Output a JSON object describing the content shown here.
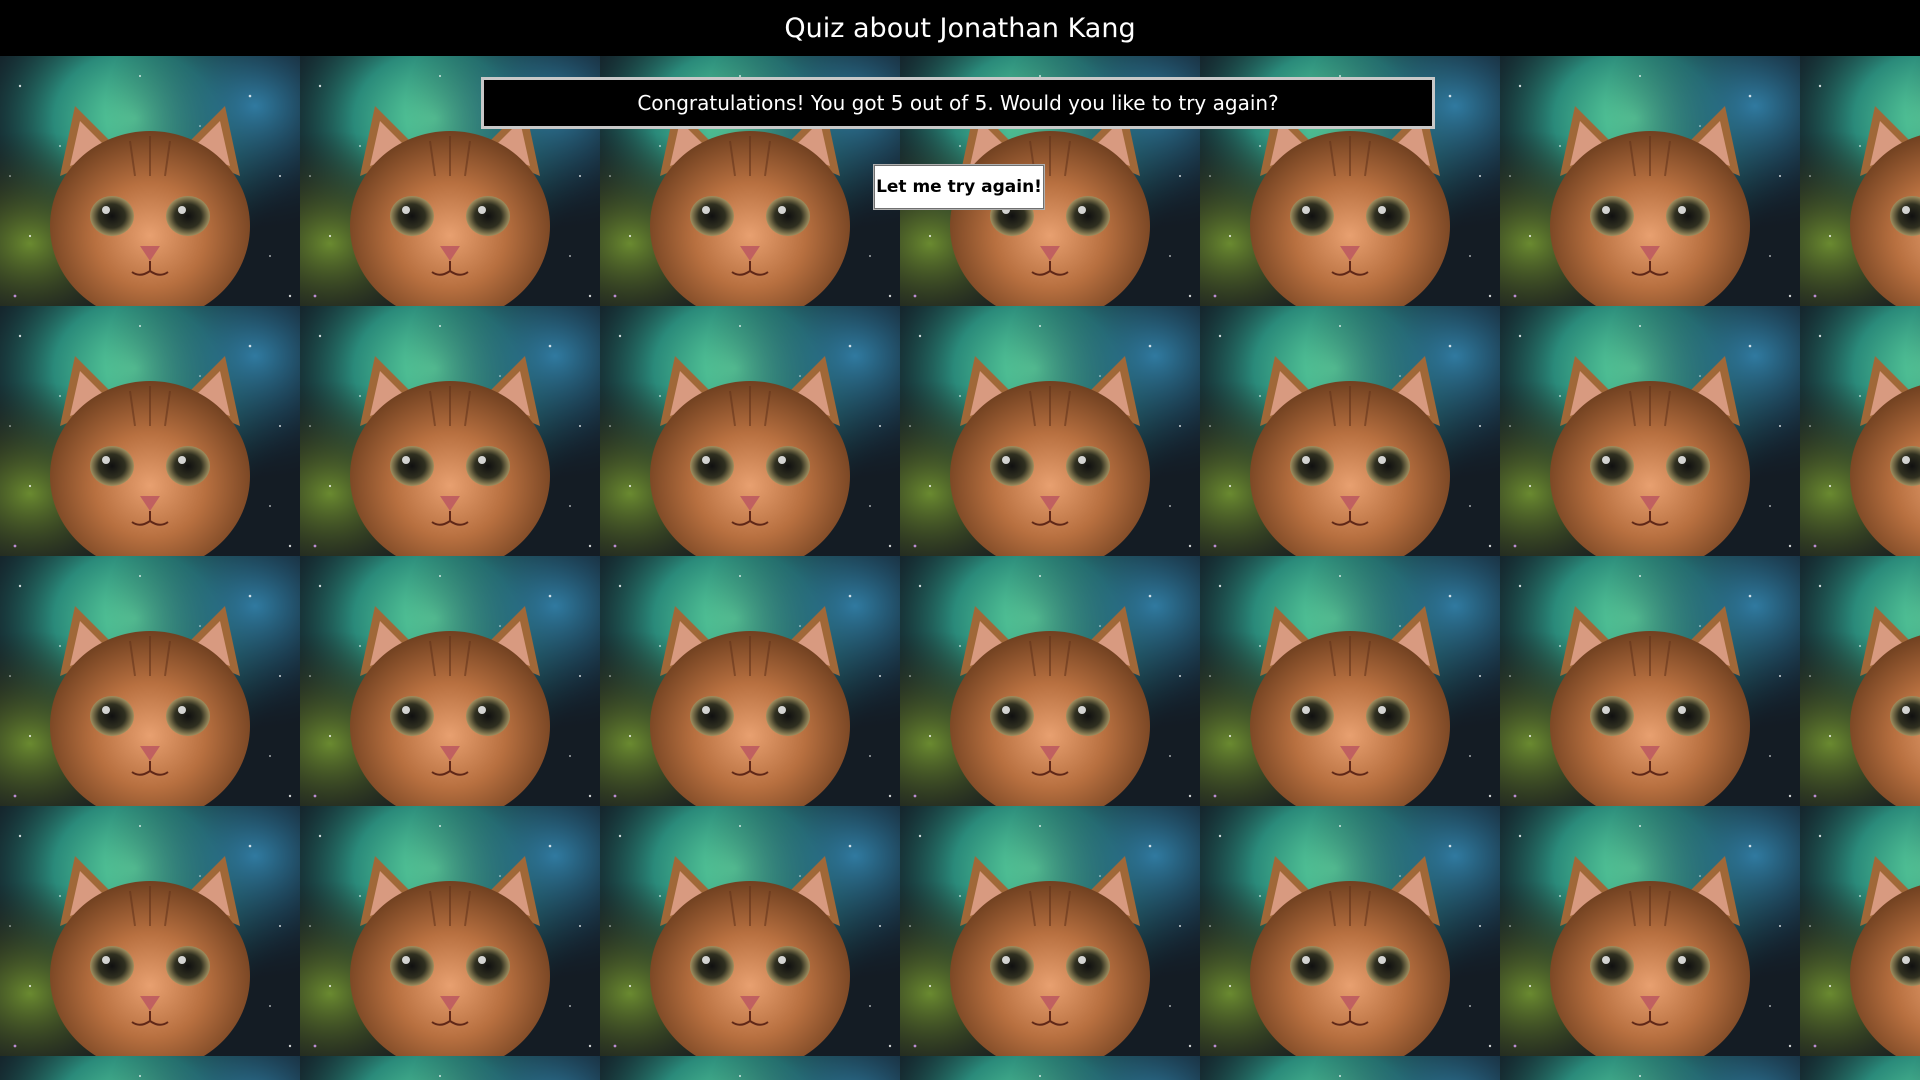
{
  "header": {
    "title": "Quiz about Jonathan Kang"
  },
  "result": {
    "message": "Congratulations! You got 5 out of 5. Would you like to try again?"
  },
  "actions": {
    "retry_label": "Let me try again!"
  },
  "background": {
    "image": "tiled-space-cat"
  },
  "colors": {
    "header_bg": "#000000",
    "header_text": "#ffffff",
    "result_bg": "#000000",
    "result_border": "#c8c8c8",
    "button_bg": "#ffffff",
    "button_text": "#000000"
  }
}
